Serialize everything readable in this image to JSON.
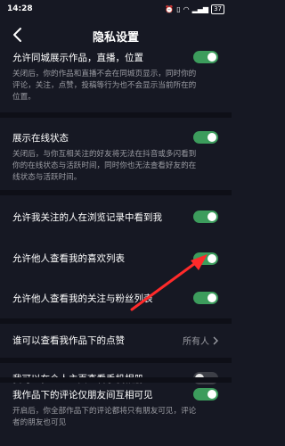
{
  "statusbar": {
    "time": "14:28",
    "battery": "37"
  },
  "header": {
    "title": "隐私设置"
  },
  "settings": [
    {
      "title": "允许同城展示作品，直播，位置",
      "desc": "关闭后，你的作品和直播不会在同城页显示，同时你的评论，关注，点赞，投稿等行为也不会显示当前所在的位置。",
      "toggle": true
    },
    {
      "title": "展示在线状态",
      "desc": "关闭后，与你互相关注的好友将无法在抖音或多闪看到你的在线状态与活跃时间，同时你也无法查看好友的在线状态与活跃时间。",
      "toggle": true
    },
    {
      "title": "允许我关注的人在浏览记录中看到我",
      "toggle": true
    },
    {
      "title": "允许他人查看我的喜欢列表",
      "toggle": true
    },
    {
      "title": "允许他人查看我的关注与粉丝列表",
      "toggle": true
    },
    {
      "title": "谁可以查看我作品下的点赞",
      "value": "所有人"
    },
    {
      "title": "我可以在个人主页查看手机相册",
      "toggle": false
    },
    {
      "title": "我作品下的评论仅朋友间互相可见",
      "desc": "开启后，你全部作品下的评论都将只有朋友可见，评论者的朋友也可见",
      "toggle": true
    }
  ],
  "colors": {
    "background": "#161823",
    "toggle_on": "#3c9c5c",
    "toggle_off": "#3d3f47",
    "annotation_arrow": "#ff2a2a"
  }
}
